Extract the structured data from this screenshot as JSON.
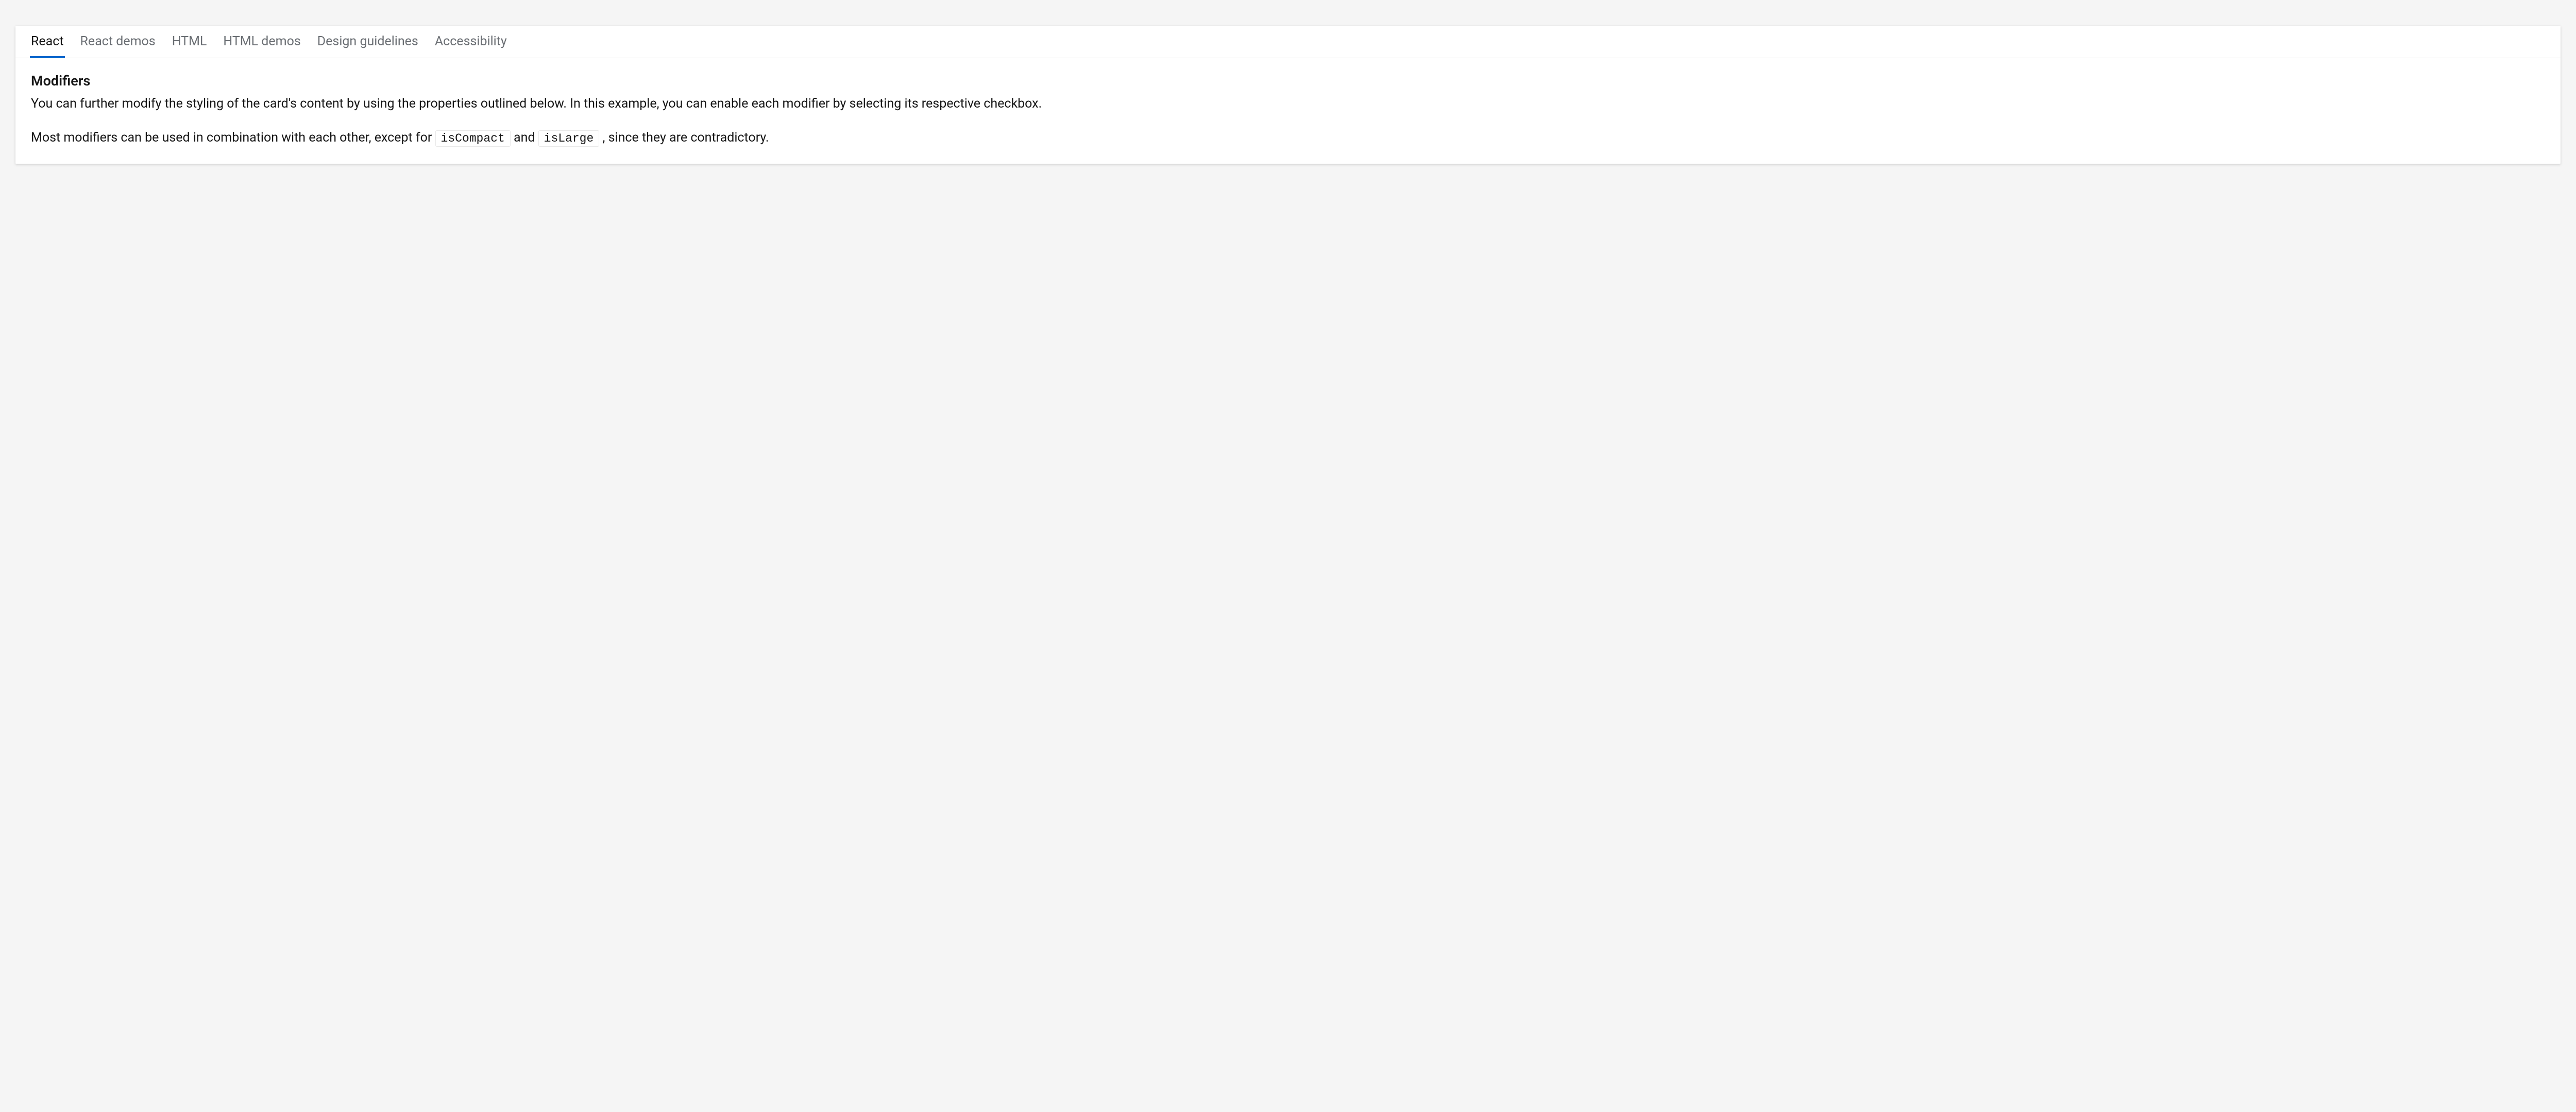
{
  "tabs": {
    "items": [
      {
        "label": "React",
        "active": true
      },
      {
        "label": "React demos",
        "active": false
      },
      {
        "label": "HTML",
        "active": false
      },
      {
        "label": "HTML demos",
        "active": false
      },
      {
        "label": "Design guidelines",
        "active": false
      },
      {
        "label": "Accessibility",
        "active": false
      }
    ]
  },
  "content": {
    "heading": "Modifiers",
    "paragraph1": "You can further modify the styling of the card's content by using the properties outlined below. In this example, you can enable each modifier by selecting its respective checkbox.",
    "paragraph2_part1": "Most modifiers can be used in combination with each other, except for ",
    "paragraph2_code1": "isCompact",
    "paragraph2_part2": " and ",
    "paragraph2_code2": "isLarge",
    "paragraph2_part3": " , since they are contradictory."
  }
}
